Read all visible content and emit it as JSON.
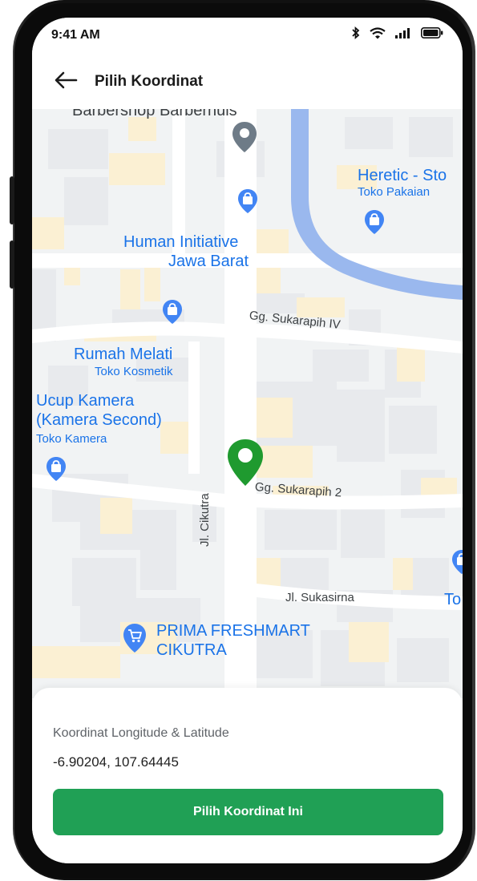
{
  "status_bar": {
    "time": "9:41 AM",
    "icons": [
      "bluetooth-icon",
      "wifi-icon",
      "signal-icon",
      "battery-icon"
    ]
  },
  "header": {
    "back_icon": "arrow-left-icon",
    "title": "Pilih Koordinat"
  },
  "map": {
    "pois": [
      {
        "name": "Barbershop Barberhuis",
        "icon": "map-pin-gray-icon"
      },
      {
        "name": "Heretic - Sto",
        "category": "Toko Pakaian",
        "icon": "shopping-bag-icon"
      },
      {
        "name": "Human Initiative",
        "name2": "Jawa Barat",
        "icon": "shopping-bag-icon"
      },
      {
        "name": "Rumah Melati",
        "category": "Toko Kosmetik",
        "icon": "shopping-bag-icon"
      },
      {
        "name": "Ucup Kamera",
        "name2": "(Kamera Second)",
        "category": "Toko Kamera",
        "icon": "shopping-bag-icon"
      },
      {
        "name": "PRIMA FRESHMART",
        "name2": "CIKUTRA",
        "icon": "shopping-cart-icon"
      },
      {
        "name": "To",
        "icon": "shopping-bag-icon"
      }
    ],
    "streets": [
      "Gg. Sukarapih IV",
      "Gg. Sukarapih 2",
      "Jl. Cikutra",
      "Jl. Sukasirna"
    ],
    "selected_marker": "location-pin-green-icon"
  },
  "sheet": {
    "label": "Koordinat Longitude & Latitude",
    "value": "-6.90204, 107.64445",
    "button_label": "Pilih Koordinat Ini"
  },
  "colors": {
    "primary": "#20a055",
    "marker": "#1f9a2f",
    "poi_text": "#1a73e8",
    "water": "#9ab8ee",
    "building": "#e8eaed",
    "building_warm": "#fbf0d3",
    "road": "#ffffff",
    "map_bg": "#f1f3f4"
  }
}
